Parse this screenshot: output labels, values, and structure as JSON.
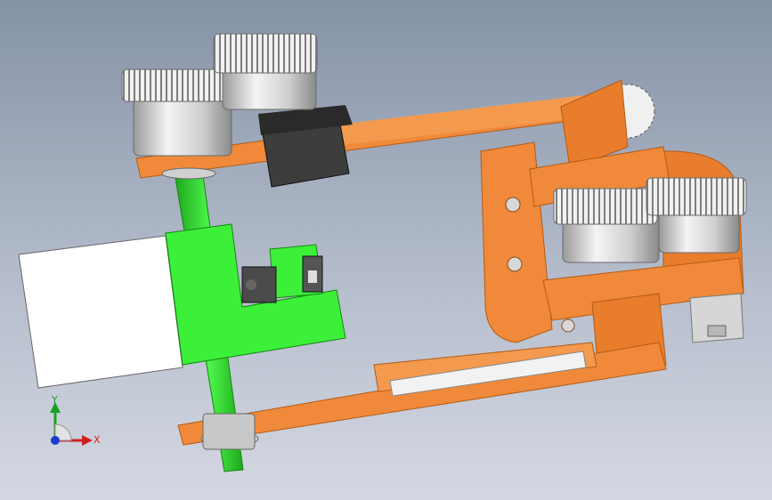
{
  "viewport": {
    "background_top": "#8593a6",
    "background_bottom": "#d4d8e2"
  },
  "model": {
    "colors": {
      "orange": "#f08a3a",
      "orange_dark": "#c9651c",
      "green": "#3cf03a",
      "green_dark": "#1fa81d",
      "servo": "#3c3c3c",
      "pulley": "#d9d9d9",
      "white_block": "#ffffff",
      "slot": "#f2f2f2"
    }
  },
  "triad": {
    "y_label": "Y",
    "x_label": "X",
    "y_color": "#19a01f",
    "x_color": "#d11f1f",
    "z_color": "#1f3ad1"
  }
}
